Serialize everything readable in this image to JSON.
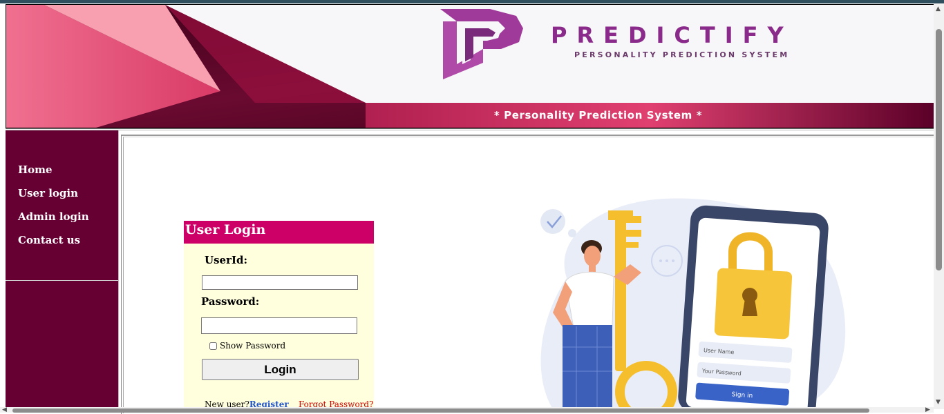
{
  "banner": {
    "brand_name": "PREDICTIFY",
    "brand_tagline": "PERSONALITY PREDICTION SYSTEM",
    "subtitle": "* Personality Prediction System *",
    "colors": {
      "brand_purple": "#8a2a8a",
      "banner_dark": "#5a0028",
      "banner_pink": "#e8557a"
    }
  },
  "sidebar": {
    "items": [
      {
        "label": "Home"
      },
      {
        "label": "User login"
      },
      {
        "label": "Admin login"
      },
      {
        "label": "Contact us"
      }
    ],
    "bg_color": "#660033"
  },
  "login": {
    "title": "User Login",
    "userid_label": "UserId:",
    "userid_value": "",
    "password_label": "Password:",
    "password_value": "",
    "show_password_label": "Show Password",
    "show_password_checked": false,
    "login_button": "Login",
    "new_user_text": "New user?",
    "register_link": "Register",
    "forgot_link": "Forgot Password?",
    "header_color": "#cc0066",
    "panel_color": "#ffffdd"
  },
  "illustration": {
    "icon": "person-with-key-and-phone-lock",
    "field_username": "User Name",
    "field_password": "Your Password",
    "sign_in_button": "Sign in"
  }
}
